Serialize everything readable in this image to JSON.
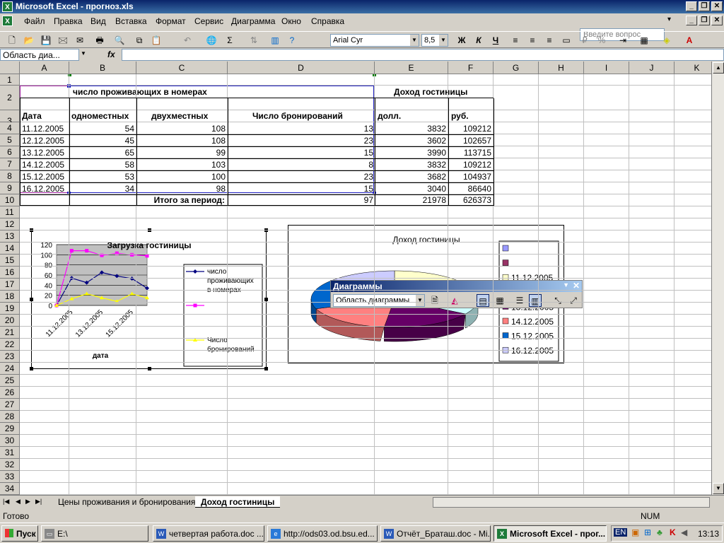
{
  "window": {
    "title": "Microsoft Excel - прогноз.xls",
    "min": "_",
    "restore": "❐",
    "close": "✕"
  },
  "menu": [
    "Файл",
    "Правка",
    "Вид",
    "Вставка",
    "Формат",
    "Сервис",
    "Диаграмма",
    "Окно",
    "Справка"
  ],
  "help_placeholder": "Введите вопрос",
  "toolbar": {
    "font": "Arial Cyr",
    "size": "8,5",
    "bold": "Ж",
    "italic": "К",
    "underline": "Ч"
  },
  "formula": {
    "namebox": "Область диа...",
    "fx": "fx"
  },
  "columns": [
    "A",
    "B",
    "C",
    "D",
    "E",
    "F",
    "G",
    "H",
    "I",
    "J",
    "K"
  ],
  "rows": [
    "1",
    "2",
    "3",
    "4",
    "5",
    "6",
    "7",
    "8",
    "9",
    "10",
    "11",
    "12",
    "13",
    "14",
    "15",
    "16",
    "17",
    "18",
    "19",
    "20",
    "21",
    "22",
    "23",
    "24",
    "25",
    "26",
    "27",
    "28",
    "29",
    "30",
    "31",
    "32",
    "33",
    "34"
  ],
  "table": {
    "header_group": "число проживающих в номерах",
    "income_group": "Доход гостиницы",
    "date": "Дата",
    "single": "одноместных",
    "double": "двухместных",
    "bookings": "Число бронирований",
    "usd": "долл.",
    "rub": "руб.",
    "rows": [
      [
        "11.12.2005",
        "54",
        "108",
        "13",
        "3832",
        "109212"
      ],
      [
        "12.12.2005",
        "45",
        "108",
        "23",
        "3602",
        "102657"
      ],
      [
        "13.12.2005",
        "65",
        "99",
        "15",
        "3990",
        "113715"
      ],
      [
        "14.12.2005",
        "58",
        "103",
        "8",
        "3832",
        "109212"
      ],
      [
        "15.12.2005",
        "53",
        "100",
        "23",
        "3682",
        "104937"
      ],
      [
        "16.12.2005",
        "34",
        "98",
        "15",
        "3040",
        "86640"
      ]
    ],
    "total_label": "Итого за период:",
    "totals": [
      "97",
      "21978",
      "626373"
    ]
  },
  "chart1": {
    "title": "Загрузка гостиницы",
    "xlabel": "дата",
    "yticks": [
      "120",
      "100",
      "80",
      "60",
      "40",
      "20",
      "0"
    ],
    "xticks": [
      "11.12.2005",
      "13.12.2005",
      "15.12.2005"
    ],
    "legend": [
      "число проживающих в номерах",
      "",
      "Число бронирований"
    ],
    "colors": {
      "s1": "#000080",
      "s2": "#ff00ff",
      "s3": "#ffff00"
    }
  },
  "chart2": {
    "title": "Доход гостиницы",
    "legend": [
      "",
      "",
      "11.12.2005",
      "12.12.2005",
      "13.12.2005",
      "14.12.2005",
      "15.12.2005",
      "16.12.2005"
    ],
    "colors": [
      "#9999ff",
      "#993366",
      "#ffffcc",
      "#ccffff",
      "#660066",
      "#ff8080",
      "#0066cc",
      "#ccccff"
    ]
  },
  "chart_toolbar": {
    "title": "Диаграммы",
    "select": "Область диаграммы"
  },
  "chart_data": [
    {
      "type": "line",
      "title": "Загрузка гостиницы",
      "xlabel": "дата",
      "ylabel": "",
      "ylim": [
        0,
        120
      ],
      "categories": [
        "",
        "11.12.2005",
        "12.12.2005",
        "13.12.2005",
        "14.12.2005",
        "15.12.2005",
        "16.12.2005"
      ],
      "series": [
        {
          "name": "число проживающих в номерах",
          "values": [
            0,
            54,
            45,
            65,
            58,
            53,
            34
          ]
        },
        {
          "name": "",
          "values": [
            0,
            108,
            108,
            99,
            103,
            100,
            98
          ]
        },
        {
          "name": "Число бронирований",
          "values": [
            0,
            13,
            23,
            15,
            8,
            23,
            15
          ]
        }
      ]
    },
    {
      "type": "pie",
      "title": "Доход гостиницы",
      "categories": [
        "11.12.2005",
        "12.12.2005",
        "13.12.2005",
        "14.12.2005",
        "15.12.2005",
        "16.12.2005"
      ],
      "values": [
        109212,
        102657,
        113715,
        109212,
        104937,
        86640
      ]
    }
  ],
  "tabs": [
    "Цены проживания и бронирования",
    "Доход гостиницы"
  ],
  "status": {
    "ready": "Готово",
    "num": "NUM"
  },
  "taskbar": {
    "start": "Пуск",
    "tasks": [
      "E:\\",
      "четвертая работа.doc ...",
      "http://ods03.od.bsu.ed...",
      "Отчёт_Браташ.doc - Mi...",
      "Microsoft Excel - прог..."
    ],
    "lang": "EN",
    "clock": "13:13"
  }
}
